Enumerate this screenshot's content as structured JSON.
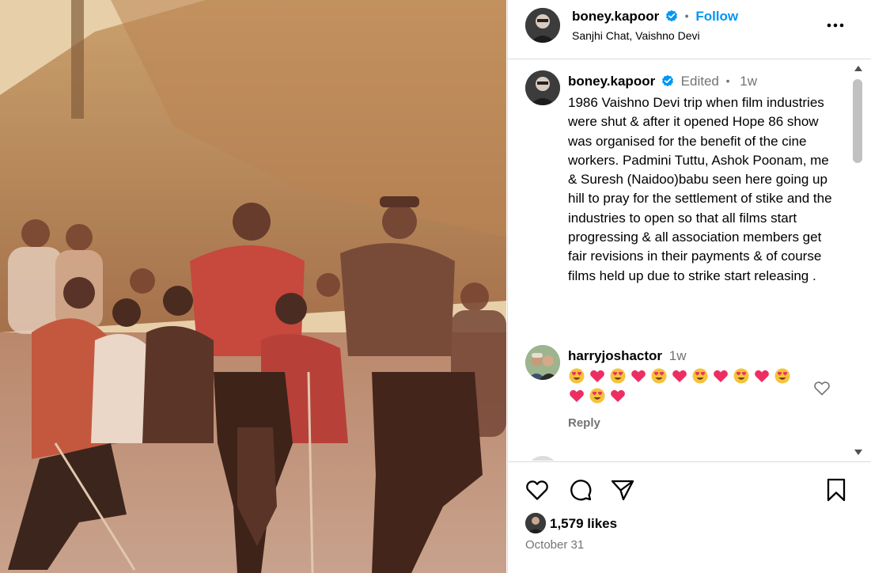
{
  "post": {
    "username": "boney.kapoor",
    "location": "Sanjhi Chat, Vaishno Devi",
    "follow_label": "Follow",
    "more_icon": "more-horizontal-icon"
  },
  "caption": {
    "username": "boney.kapoor",
    "edited_label": "Edited",
    "time": "1w",
    "text": "1986 Vaishno Devi trip when film industries were shut & after it opened Hope 86 show was organised for the benefit of the cine workers.  Padmini Tuttu, Ashok Poonam, me & Suresh (Naidoo)babu seen here going up hill to pray for the settlement of stike and the industries to open so that all films start progressing & all association members get fair revisions in their payments & of course films held up due to strike start releasing ."
  },
  "comment": {
    "username": "harryjoshactor",
    "time": "1w",
    "emojis": [
      "heart-eyes",
      "heart",
      "heart-eyes",
      "heart",
      "heart-eyes",
      "heart",
      "heart-eyes",
      "heart",
      "heart-eyes",
      "heart",
      "heart-eyes",
      "heart",
      "heart-eyes",
      "heart"
    ],
    "reply_label": "Reply"
  },
  "footer": {
    "likes": "1,579 likes",
    "date": "October 31"
  },
  "colors": {
    "accent": "#0095f6",
    "muted": "#737373",
    "border": "#dbdbdb",
    "heart": "#ed2e63",
    "emoji_face": "#f5c33b"
  }
}
